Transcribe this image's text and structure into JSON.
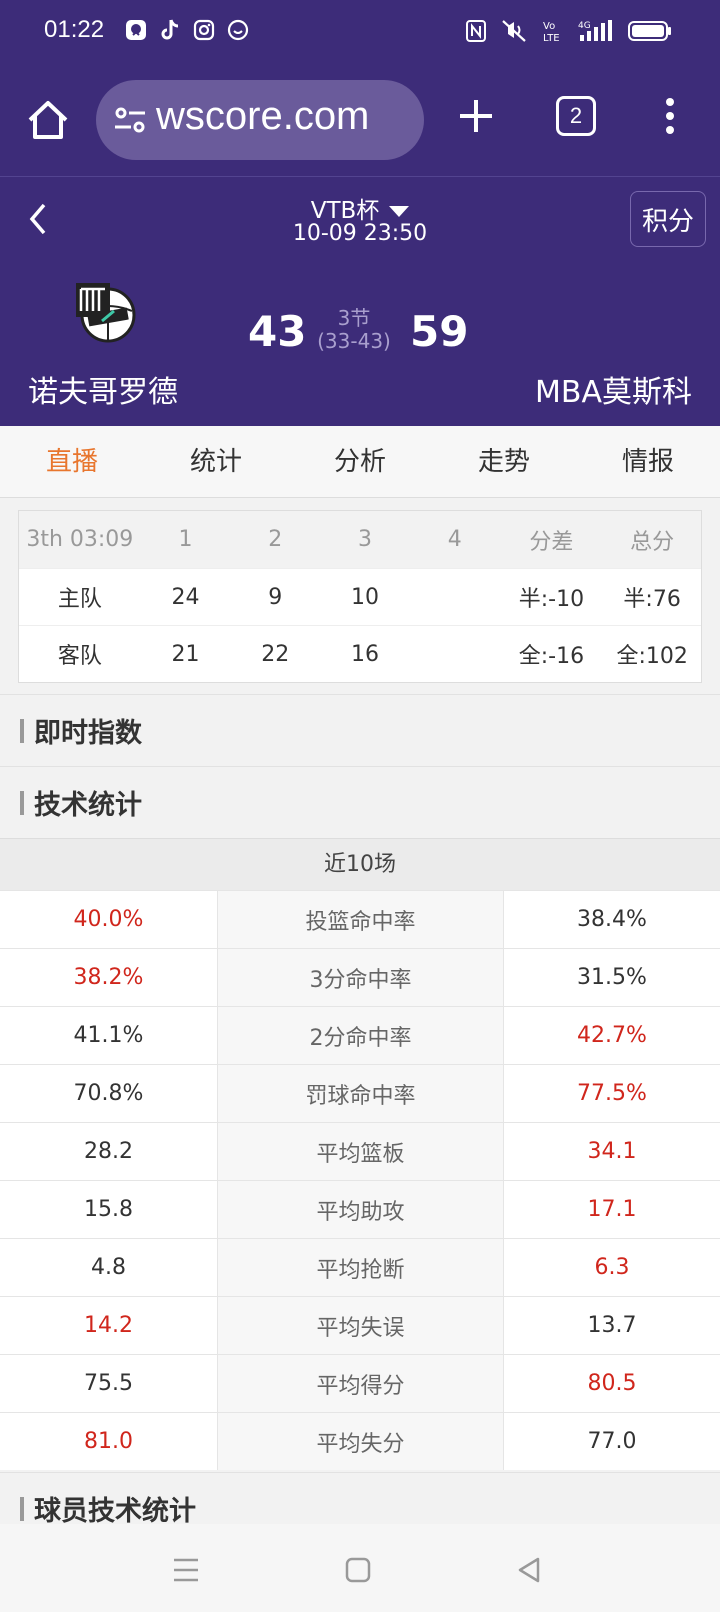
{
  "status_bar": {
    "time": "01:22",
    "app_icons": [
      "messenger-icon",
      "tiktok-icon",
      "instagram-icon",
      "chat-icon"
    ],
    "right_icons": [
      "nfc-icon",
      "mute-icon",
      "volte-icon",
      "signal-4g-icon",
      "battery-icon"
    ],
    "network": "4G"
  },
  "browser": {
    "url": "wscore.com",
    "tab_count": "2"
  },
  "game": {
    "league": "VTB杯",
    "datetime": "10-09 23:50",
    "standings_button": "积分",
    "home_team": "诺夫哥罗德",
    "away_team": "MBA莫斯科",
    "home_score": "43",
    "away_score": "59",
    "period": "3节",
    "period_score": "(33-43)"
  },
  "tabs": [
    "直播",
    "统计",
    "分析",
    "走势",
    "情报"
  ],
  "quarters": {
    "header": [
      "3th 03:09",
      "1",
      "2",
      "3",
      "4",
      "分差",
      "总分"
    ],
    "rows": [
      [
        "主队",
        "24",
        "9",
        "10",
        "",
        "半:-10",
        "半:76"
      ],
      [
        "客队",
        "21",
        "22",
        "16",
        "",
        "全:-16",
        "全:102"
      ]
    ]
  },
  "sections": {
    "live_odds": "即时指数",
    "tech_stats": "技术统计",
    "player_stats": "球员技术统计"
  },
  "tech_stats": {
    "header": "近10场",
    "rows": [
      {
        "home": "40.0%",
        "label": "投篮命中率",
        "away": "38.4%",
        "home_red": true,
        "away_red": false
      },
      {
        "home": "38.2%",
        "label": "3分命中率",
        "away": "31.5%",
        "home_red": true,
        "away_red": false
      },
      {
        "home": "41.1%",
        "label": "2分命中率",
        "away": "42.7%",
        "home_red": false,
        "away_red": true
      },
      {
        "home": "70.8%",
        "label": "罚球命中率",
        "away": "77.5%",
        "home_red": false,
        "away_red": true
      },
      {
        "home": "28.2",
        "label": "平均篮板",
        "away": "34.1",
        "home_red": false,
        "away_red": true
      },
      {
        "home": "15.8",
        "label": "平均助攻",
        "away": "17.1",
        "home_red": false,
        "away_red": true
      },
      {
        "home": "4.8",
        "label": "平均抢断",
        "away": "6.3",
        "home_red": false,
        "away_red": true
      },
      {
        "home": "14.2",
        "label": "平均失误",
        "away": "13.7",
        "home_red": true,
        "away_red": false
      },
      {
        "home": "75.5",
        "label": "平均得分",
        "away": "80.5",
        "home_red": false,
        "away_red": true
      },
      {
        "home": "81.0",
        "label": "平均失分",
        "away": "77.0",
        "home_red": true,
        "away_red": false
      }
    ]
  },
  "colors": {
    "header_bg": "#3d2c79",
    "active_tab": "#e8762e",
    "highlight_red": "#d0261c"
  }
}
